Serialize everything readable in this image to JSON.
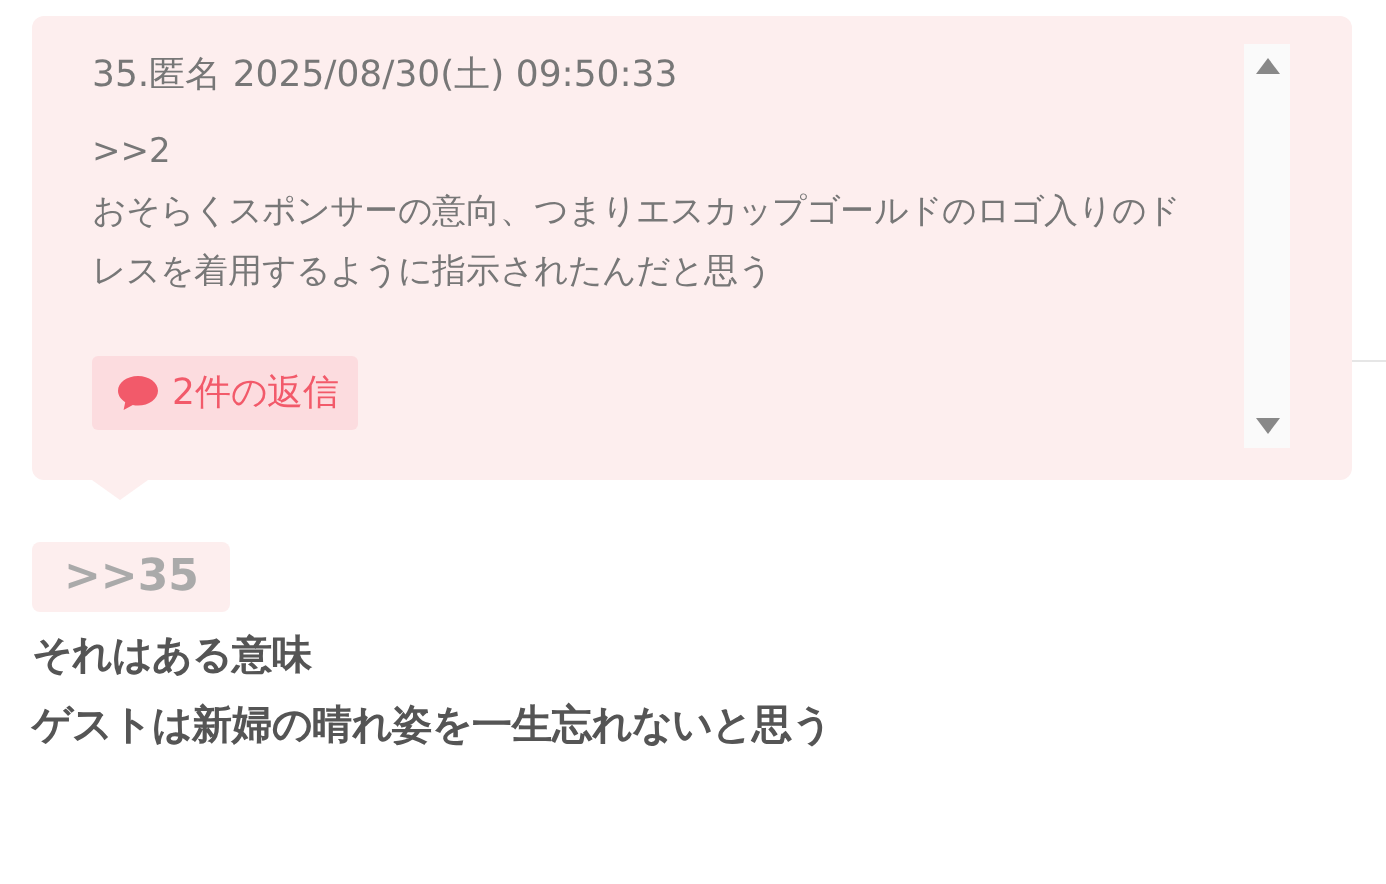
{
  "quoted_post": {
    "header": "35.匿名 2025/08/30(土) 09:50:33",
    "lines": [
      ">>2",
      "おそらくスポンサーの意向、つまりエスカップゴールドのロゴ入りのドレスを着用するように指示されたんだと思う"
    ],
    "reply_button": "2件の返信"
  },
  "reply": {
    "anchor": ">>35",
    "lines": [
      "それはある意味",
      "ゲストは新婦の晴れ姿を一生忘れないと思う"
    ]
  }
}
